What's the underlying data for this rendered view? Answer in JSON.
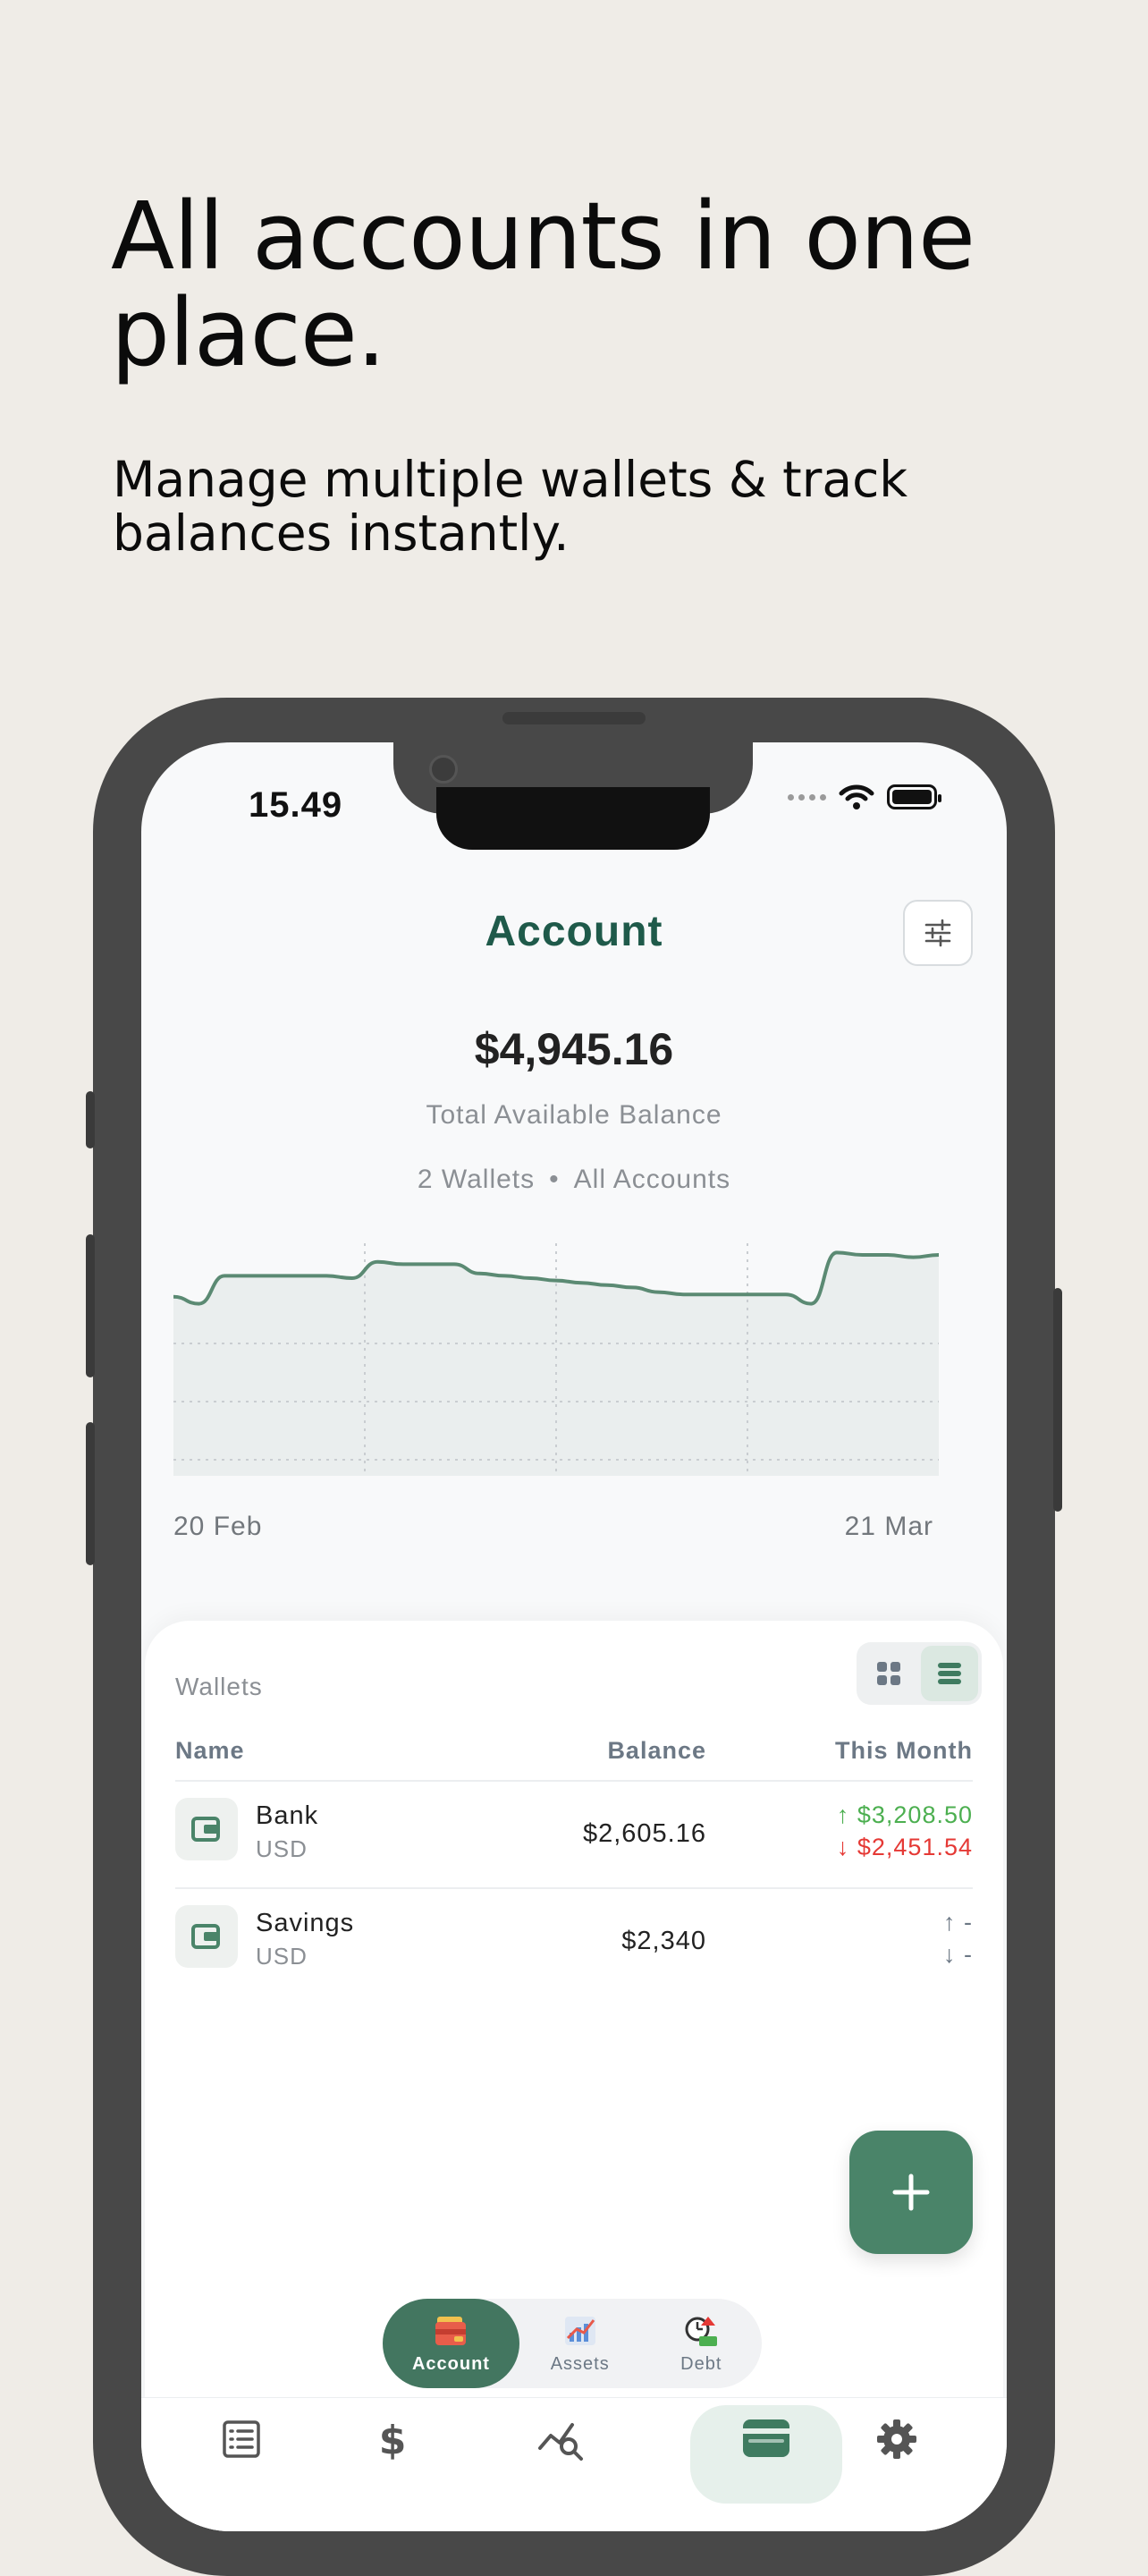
{
  "promo": {
    "headline": "All accounts in one place.",
    "subheadline": "Manage multiple wallets & track balances instantly."
  },
  "status_bar": {
    "time": "15.49"
  },
  "header": {
    "title": "Account",
    "filter_icon": "sliders-icon"
  },
  "summary": {
    "balance": "$4,945.16",
    "balance_label": "Total Available Balance",
    "wallet_count": "2 Wallets",
    "separator": "•",
    "scope": "All Accounts"
  },
  "chart_data": {
    "type": "area",
    "x_start_label": "20 Feb",
    "x_end_label": "21 Mar",
    "y_relative": [
      0.77,
      0.74,
      0.86,
      0.86,
      0.86,
      0.86,
      0.86,
      0.85,
      0.92,
      0.91,
      0.91,
      0.91,
      0.87,
      0.86,
      0.85,
      0.84,
      0.83,
      0.82,
      0.81,
      0.79,
      0.78,
      0.78,
      0.78,
      0.78,
      0.78,
      0.74,
      0.96,
      0.95,
      0.95,
      0.94,
      0.95
    ],
    "grid": true,
    "line_color": "#5b8a73",
    "fill_color": "#e8ecec"
  },
  "wallets": {
    "label": "Wallets",
    "view_icons": [
      "grid-icon",
      "list-icon"
    ],
    "columns": {
      "name": "Name",
      "balance": "Balance",
      "month": "This Month"
    },
    "rows": [
      {
        "name": "Bank",
        "currency": "USD",
        "balance": "$2,605.16",
        "income": "↑ $3,208.50",
        "expense": "↓ $2,451.54"
      },
      {
        "name": "Savings",
        "currency": "USD",
        "balance": "$2,340",
        "income": "↑ -",
        "expense": "↓ -"
      }
    ]
  },
  "segments": [
    {
      "label": "Account",
      "icon": "wallet-cards-icon",
      "active": true
    },
    {
      "label": "Assets",
      "icon": "assets-chart-icon",
      "active": false
    },
    {
      "label": "Debt",
      "icon": "debt-clock-icon",
      "active": false
    }
  ],
  "tabbar": [
    "list-icon",
    "dollar-icon",
    "analytics-search-icon",
    "wallet-icon",
    "gear-icon"
  ],
  "colors": {
    "accent": "#1f5a4a",
    "button": "#4a8469",
    "income": "#4caf50",
    "expense": "#e53935"
  }
}
